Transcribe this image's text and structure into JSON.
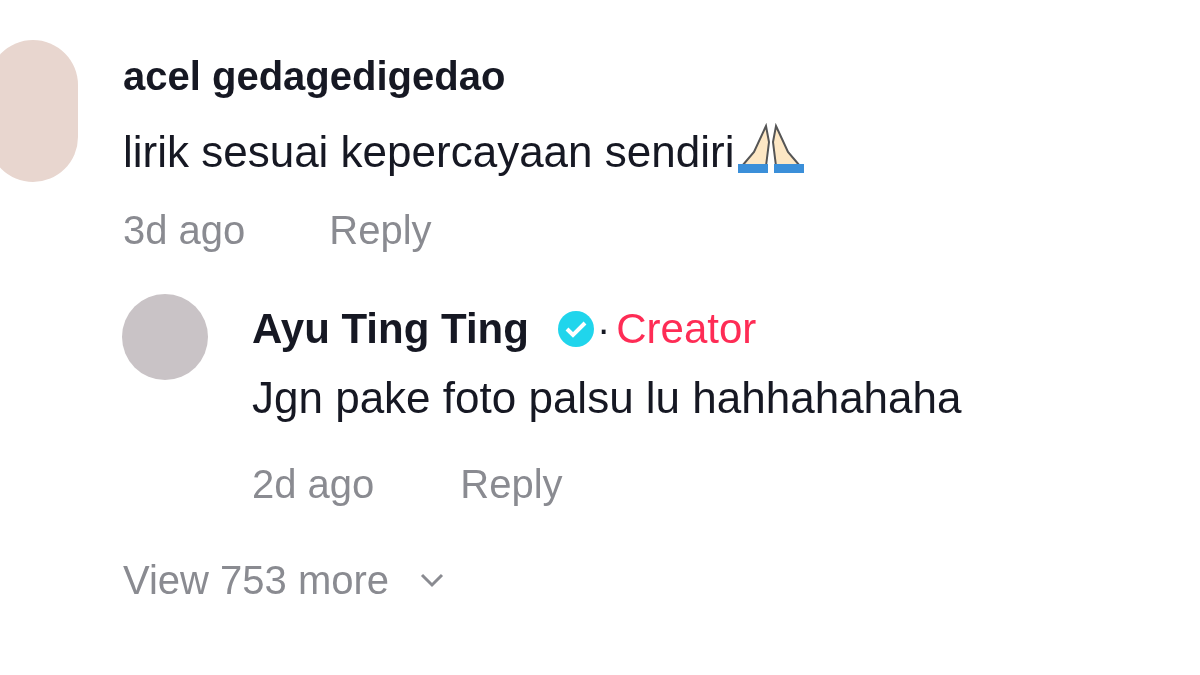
{
  "comment": {
    "username": "acel gedagedigedao",
    "text": "lirik sesuai kepercayaan sendiri",
    "time": "3d ago",
    "reply_label": "Reply"
  },
  "reply": {
    "username": "Ayu Ting Ting",
    "verified": true,
    "badge": "Creator",
    "separator": "·",
    "text": "Jgn pake foto palsu lu hahhahahaha",
    "time": "2d ago",
    "reply_label": "Reply"
  },
  "view_more": "View 753 more"
}
